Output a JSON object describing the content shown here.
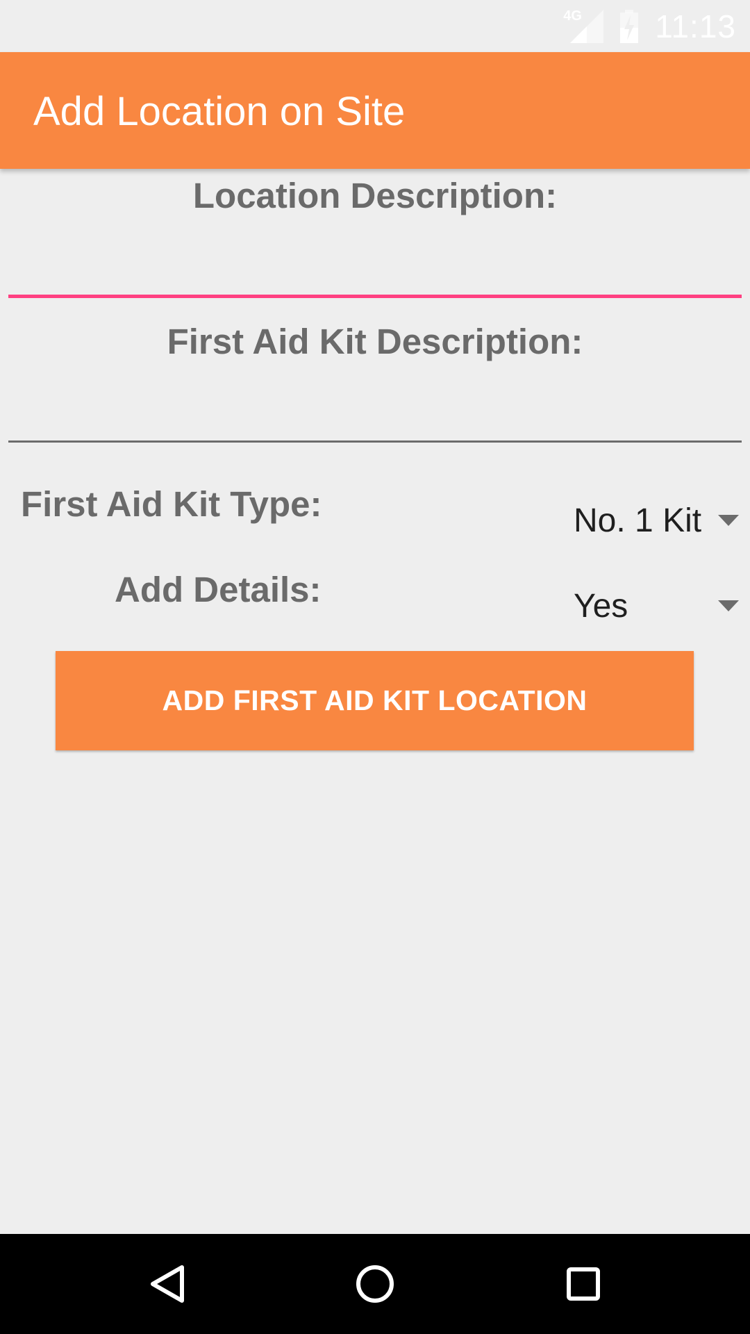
{
  "status_bar": {
    "network": "4G",
    "time": "11:13",
    "icons": [
      "signal-icon",
      "battery-icon"
    ]
  },
  "app_bar": {
    "title": "Add Location on Site",
    "color": "#f98741"
  },
  "form": {
    "location_description": {
      "label": "Location Description:",
      "value": ""
    },
    "first_aid_kit_description": {
      "label": "First Aid Kit Description:",
      "value": ""
    },
    "kit_type": {
      "label": "First Aid Kit Type:",
      "selected": "No. 1 Kit"
    },
    "add_details": {
      "label": "Add Details:",
      "selected": "Yes"
    },
    "submit_label": "ADD FIRST AID KIT LOCATION"
  },
  "colors": {
    "accent": "#f98741",
    "focus_underline": "#ff4081",
    "label_text": "#6a6a6a"
  },
  "nav_bar": {
    "icons": [
      "back-icon",
      "home-icon",
      "recents-icon"
    ]
  }
}
